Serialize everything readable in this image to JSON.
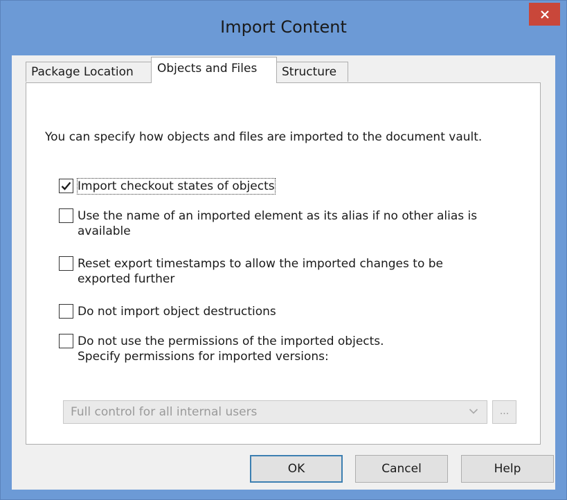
{
  "window": {
    "title": "Import Content"
  },
  "tabs": [
    {
      "label": "Package Location",
      "active": false
    },
    {
      "label": "Objects and Files",
      "active": true
    },
    {
      "label": "Structure",
      "active": false
    }
  ],
  "panel": {
    "description": "You can specify how objects and files are imported to the document vault.",
    "options": [
      {
        "label": "Import checkout states of objects",
        "checked": true
      },
      {
        "label_line1": "Use the name of an imported element as its alias if no other alias is",
        "label_line2": "available",
        "checked": false
      },
      {
        "label_line1": "Reset export timestamps to allow the imported changes to be",
        "label_line2": "exported further",
        "checked": false
      },
      {
        "label": "Do not import object destructions",
        "checked": false
      },
      {
        "label_line1": "Do not use the permissions of the imported objects.",
        "label_line2": "Specify permissions for imported versions:",
        "checked": false
      }
    ],
    "permissions_select": {
      "value": "Full control for all internal users",
      "enabled": false
    },
    "browse_label": "..."
  },
  "buttons": {
    "ok": "OK",
    "cancel": "Cancel",
    "help": "Help"
  },
  "colors": {
    "titlebar": "#6c9ad6",
    "close": "#c9473a",
    "dialog_bg": "#f0f0f0",
    "default_button_border": "#3c7fb1"
  },
  "icons": {
    "close": "close-icon",
    "check": "checkmark-icon",
    "dropdown": "chevron-down-icon"
  }
}
